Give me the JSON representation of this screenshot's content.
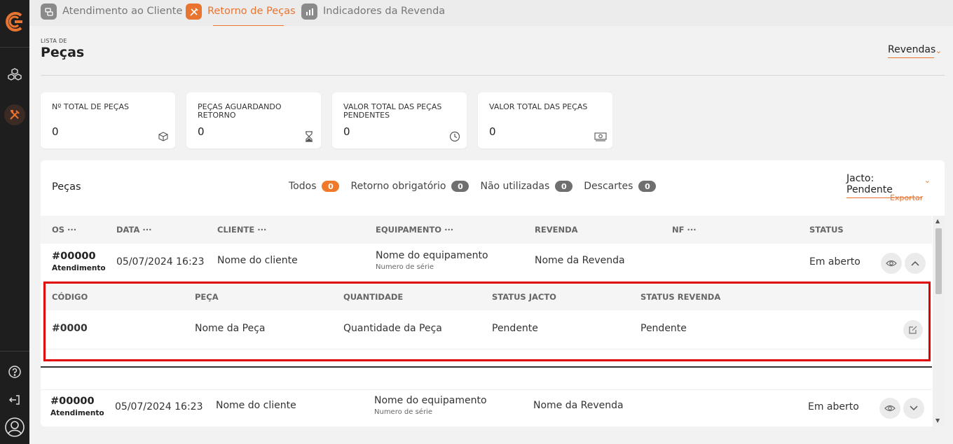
{
  "tabs": [
    {
      "label": "Atendimento ao Cliente",
      "icon": "chat-icon"
    },
    {
      "label": "Retorno de Peças",
      "icon": "tools-icon",
      "active": true
    },
    {
      "label": "Indicadores da Revenda",
      "icon": "bar-chart-icon"
    }
  ],
  "header": {
    "eyebrow": "LISTA DE",
    "title": "Peças",
    "revendas_label": "Revendas"
  },
  "cards": [
    {
      "title": "Nº TOTAL DE PEÇAS",
      "value": "0",
      "icon": "box-icon"
    },
    {
      "title": "PEÇAS AGUARDANDO RETORNO",
      "value": "0",
      "icon": "hourglass-icon"
    },
    {
      "title": "VALOR TOTAL DAS PEÇAS PENDENTES",
      "value": "0",
      "icon": "clock-icon"
    },
    {
      "title": "VALOR TOTAL DAS PEÇAS",
      "value": "0",
      "icon": "money-icon"
    }
  ],
  "panel": {
    "title": "Peças",
    "filters": [
      {
        "label": "Todos",
        "count": "0",
        "active": true
      },
      {
        "label": "Retorno obrigatório",
        "count": "0"
      },
      {
        "label": "Não utilizadas",
        "count": "0"
      },
      {
        "label": "Descartes",
        "count": "0"
      }
    ],
    "status_select": "Jacto: Pendente",
    "export_label": "Exportar"
  },
  "table": {
    "columns": [
      "OS ···",
      "DATA ···",
      "CLIENTE ···",
      "EQUIPAMENTO ···",
      "REVENDA",
      "NF ···",
      "STATUS"
    ],
    "rows": [
      {
        "os": "#00000",
        "os_sub": "Atendimento",
        "date": "05/07/2024 16:23",
        "client": "Nome do cliente",
        "equipment": "Nome do equipamento",
        "serial": "Numero de série",
        "revenda": "Nome da Revenda",
        "status": "Em aberto"
      },
      {
        "os": "#00000",
        "os_sub": "Atendimento",
        "date": "05/07/2024 16:23",
        "client": "Nome do cliente",
        "equipment": "Nome do equipamento",
        "serial": "Numero de série",
        "revenda": "Nome da Revenda",
        "status": "Em aberto"
      }
    ]
  },
  "subtable": {
    "columns": [
      "CÓDIGO",
      "PEÇA",
      "QUANTIDADE",
      "STATUS JACTO",
      "STATUS REVENDA"
    ],
    "rows": [
      {
        "code": "#0000",
        "part": "Nome da Peça",
        "qty": "Quantidade da Peça",
        "status_jacto": "Pendente",
        "status_revenda": "Pendente"
      }
    ]
  },
  "colors": {
    "accent": "#e8742f",
    "sidebar": "#1e1e1e",
    "highlight": "#e00000"
  }
}
